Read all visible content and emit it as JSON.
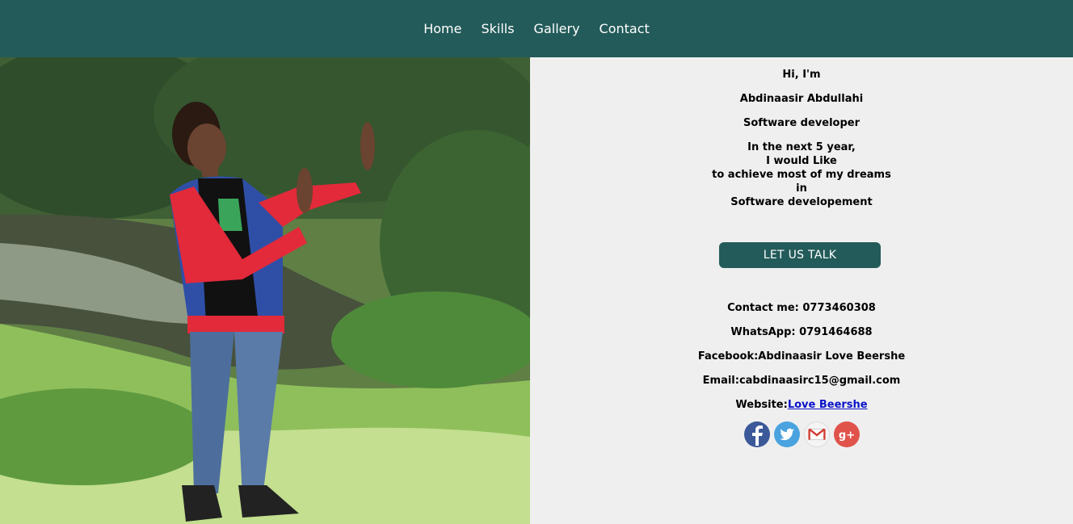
{
  "nav": {
    "items": [
      {
        "label": "Home"
      },
      {
        "label": "Skills"
      },
      {
        "label": "Gallery"
      },
      {
        "label": "Contact"
      }
    ]
  },
  "intro": {
    "greeting": "Hi, I'm",
    "name": "Abdinaasir Abdullahi",
    "role": "Software developer",
    "goal_lines": [
      "In the next 5 year,",
      "I would Like",
      "to achieve most of my dreams",
      "in",
      "Software developement"
    ]
  },
  "cta": {
    "label": "LET US TALK"
  },
  "contact": {
    "phone": "Contact me: 0773460308",
    "whatsapp": "WhatsApp: 0791464688",
    "facebook": "Facebook:Abdinaasir Love Beershe",
    "email": "Email:cabdinaasirc15@gmail.com",
    "website_prefix": "Website:",
    "website_link": "Love Beershe"
  },
  "socials": [
    {
      "name": "facebook",
      "glyph": "f",
      "color": "#3b5998"
    },
    {
      "name": "twitter",
      "glyph": "",
      "color": "#4aa3df"
    },
    {
      "name": "gmail",
      "glyph": "M",
      "color": "#ffffff"
    },
    {
      "name": "google-plus",
      "glyph": "g+",
      "color": "#e0534a"
    }
  ],
  "colors": {
    "nav_bg": "#235b5a",
    "page_bg": "#efefef",
    "link": "#0a13c8"
  }
}
